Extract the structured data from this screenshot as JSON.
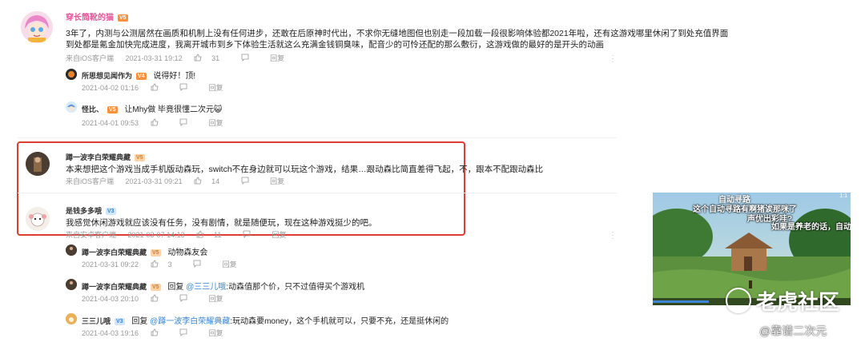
{
  "comments": [
    {
      "user": "穿长筒靴的猫",
      "badge": "V5",
      "text_line1": "3年了，内测与公测居然在画质和机制上没有任何进步，还敢在后原神时代出，不求你无缝地图但也别走一段加载一段很影响体验都2021年啦，还有这游戏哪里休闲了到处充值界面",
      "text_line2": "到处都是氪金加快完成进度，我离开城市到乡下体验生活就这么充满金钱铜臭味，配音少的可怜还配的那么敷衍，这游戏做的最好的是开头的动画",
      "meta": {
        "client": "来自iOS客户端",
        "time": "2021-03-31 19:12",
        "likes": "31",
        "reply": "回复"
      },
      "replies": [
        {
          "user": "所思想见闻作为",
          "badge": "V4",
          "text": "说得好！顶!",
          "time": "2021-04-02 01:16",
          "reply": "回复"
        },
        {
          "user": "怪比、",
          "badge": "V5",
          "text": "让Mhy做 毕竟很懂二次元😺",
          "time": "2021-04-01 09:53",
          "reply": "回复"
        }
      ]
    },
    {
      "user": "蹲一波李白荣耀典藏",
      "badge": "V5",
      "text": "本来想把这个游戏当成手机版动森玩，switch不在身边就可以玩这个游戏，结果…跟动森比简直差得飞起，不，跟本不配跟动森比",
      "meta": {
        "client": "来自iOS客户端",
        "time": "2021-03-31 09:21",
        "likes": "14",
        "reply": "回复"
      }
    },
    {
      "user": "是钱多多哦",
      "badge": "V3",
      "text": "我感觉休闲游戏就应该没有任务，没有剧情，就是随便玩，现在这种游戏挺少的吧。",
      "meta": {
        "client": "来自安卓客户端",
        "time": "2021-03-07 14:13",
        "likes": "11",
        "reply": "回复"
      },
      "replies": [
        {
          "user": "蹲一波李白荣耀典藏",
          "badge": "V5",
          "prefix": "",
          "mention": "",
          "text": "动物森友会",
          "time": "2021-03-31 09:22",
          "likes": "3",
          "reply": "回复"
        },
        {
          "user": "蹲一波李白荣耀典藏",
          "badge": "V5",
          "prefix": "回复 ",
          "mention": "@三三儿哦",
          "text": ":动森值那个价，只不过值得买个游戏机",
          "time": "2021-04-03 20:10",
          "reply": "回复"
        },
        {
          "user": "三三儿哦",
          "badge": "V3",
          "prefix": "回复 ",
          "mention": "@蹲一波李白荣耀典藏",
          "text": ":玩动森要money，这个手机就可以，只要不充，还是挺休闲的",
          "time": "2021-04-03 19:16",
          "reply": "回复"
        }
      ]
    }
  ],
  "video": {
    "title": "自动寻路",
    "subtitle1": "这个自动寻路有啊猪诶那咪了",
    "subtitle2": "声优出彩哇?",
    "subtitle3": "如果是养老的话，自动",
    "corner": "1:1"
  },
  "watermark": {
    "logo": "老虎社区",
    "credit": "@靠谱二次元"
  },
  "colors": {
    "highlight_border": "#e23a35",
    "name_pink": "#e6559a",
    "mention": "#3a86d4"
  }
}
